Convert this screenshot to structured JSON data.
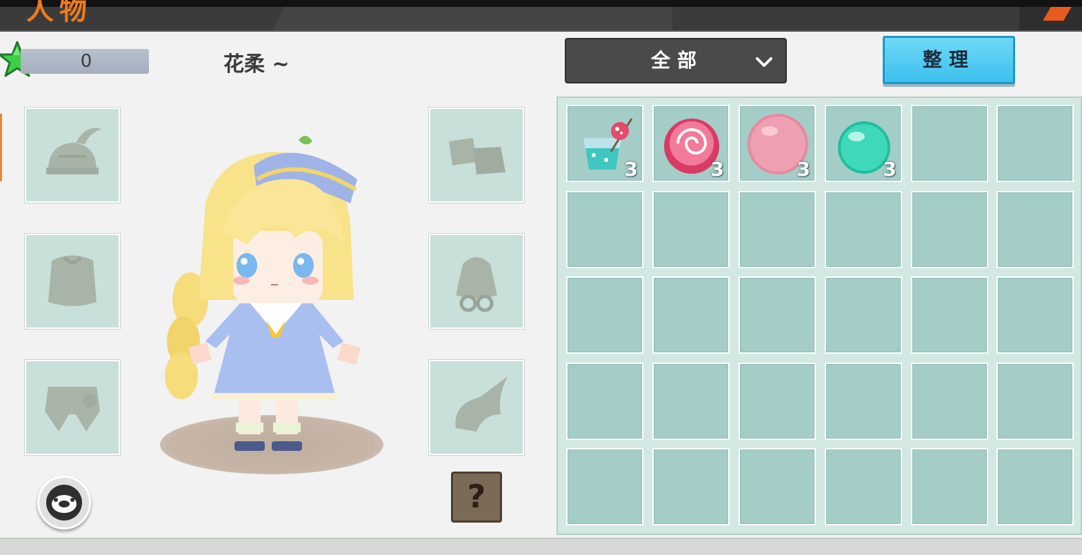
{
  "header": {
    "title_fragment": "人物"
  },
  "player": {
    "score": "0",
    "name": "花柔 ~"
  },
  "equipment_slots": [
    {
      "position": "left-1",
      "icon": "helmet-icon"
    },
    {
      "position": "left-2",
      "icon": "armor-icon"
    },
    {
      "position": "left-3",
      "icon": "pants-icon"
    },
    {
      "position": "right-1",
      "icon": "boots-icon"
    },
    {
      "position": "right-2",
      "icon": "backpack-icon"
    },
    {
      "position": "right-3",
      "icon": "wings-icon"
    }
  ],
  "buttons": {
    "help_label": "?",
    "avatar_icon": "pig-face-icon"
  },
  "filter": {
    "selected": "全部",
    "icon": "chevron-down-icon"
  },
  "sort_button": {
    "label": "整理"
  },
  "inventory": {
    "columns": 6,
    "rows": 5,
    "items": [
      {
        "name": "fruit-drink-icon",
        "count": "3"
      },
      {
        "name": "swirl-candy-icon",
        "count": "3"
      },
      {
        "name": "pink-ball-icon",
        "count": "3"
      },
      {
        "name": "teal-orb-icon",
        "count": "3"
      }
    ]
  },
  "colors": {
    "accent_orange": "#f07a1b",
    "sort_button": "#4cc8f2",
    "cell": "#a4cdc8",
    "star": "#3ccf4a"
  }
}
